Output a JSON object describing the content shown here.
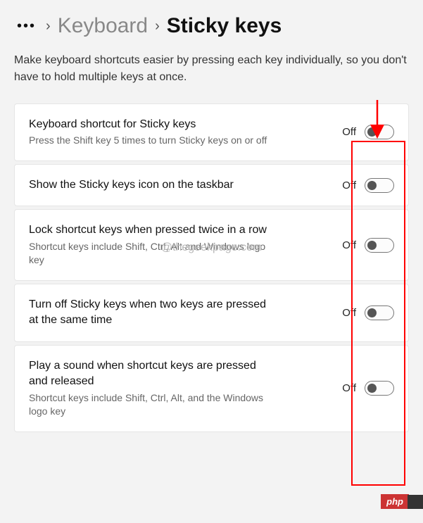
{
  "breadcrumb": {
    "link": "Keyboard",
    "current": "Sticky keys"
  },
  "description": "Make keyboard shortcuts easier by pressing each key individually, so you don't have to hold multiple keys at once.",
  "settings": [
    {
      "title": "Keyboard shortcut for Sticky keys",
      "subtitle": "Press the Shift key 5 times to turn Sticky keys on or off",
      "state": "Off"
    },
    {
      "title": "Show the Sticky keys icon on the taskbar",
      "subtitle": "",
      "state": "Off"
    },
    {
      "title": "Lock shortcut keys when pressed twice in a row",
      "subtitle": "Shortcut keys include Shift, Ctrl, Alt and Windows logo key",
      "state": "Off"
    },
    {
      "title": "Turn off Sticky keys when two keys are pressed at the same time",
      "subtitle": "",
      "state": "Off"
    },
    {
      "title": "Play a sound when shortcut keys are pressed and released",
      "subtitle": "Shortcut keys include Shift, Ctrl, Alt, and the Windows logo key",
      "state": "Off"
    }
  ],
  "watermark": "@thegeekpage.com",
  "badge": "php"
}
